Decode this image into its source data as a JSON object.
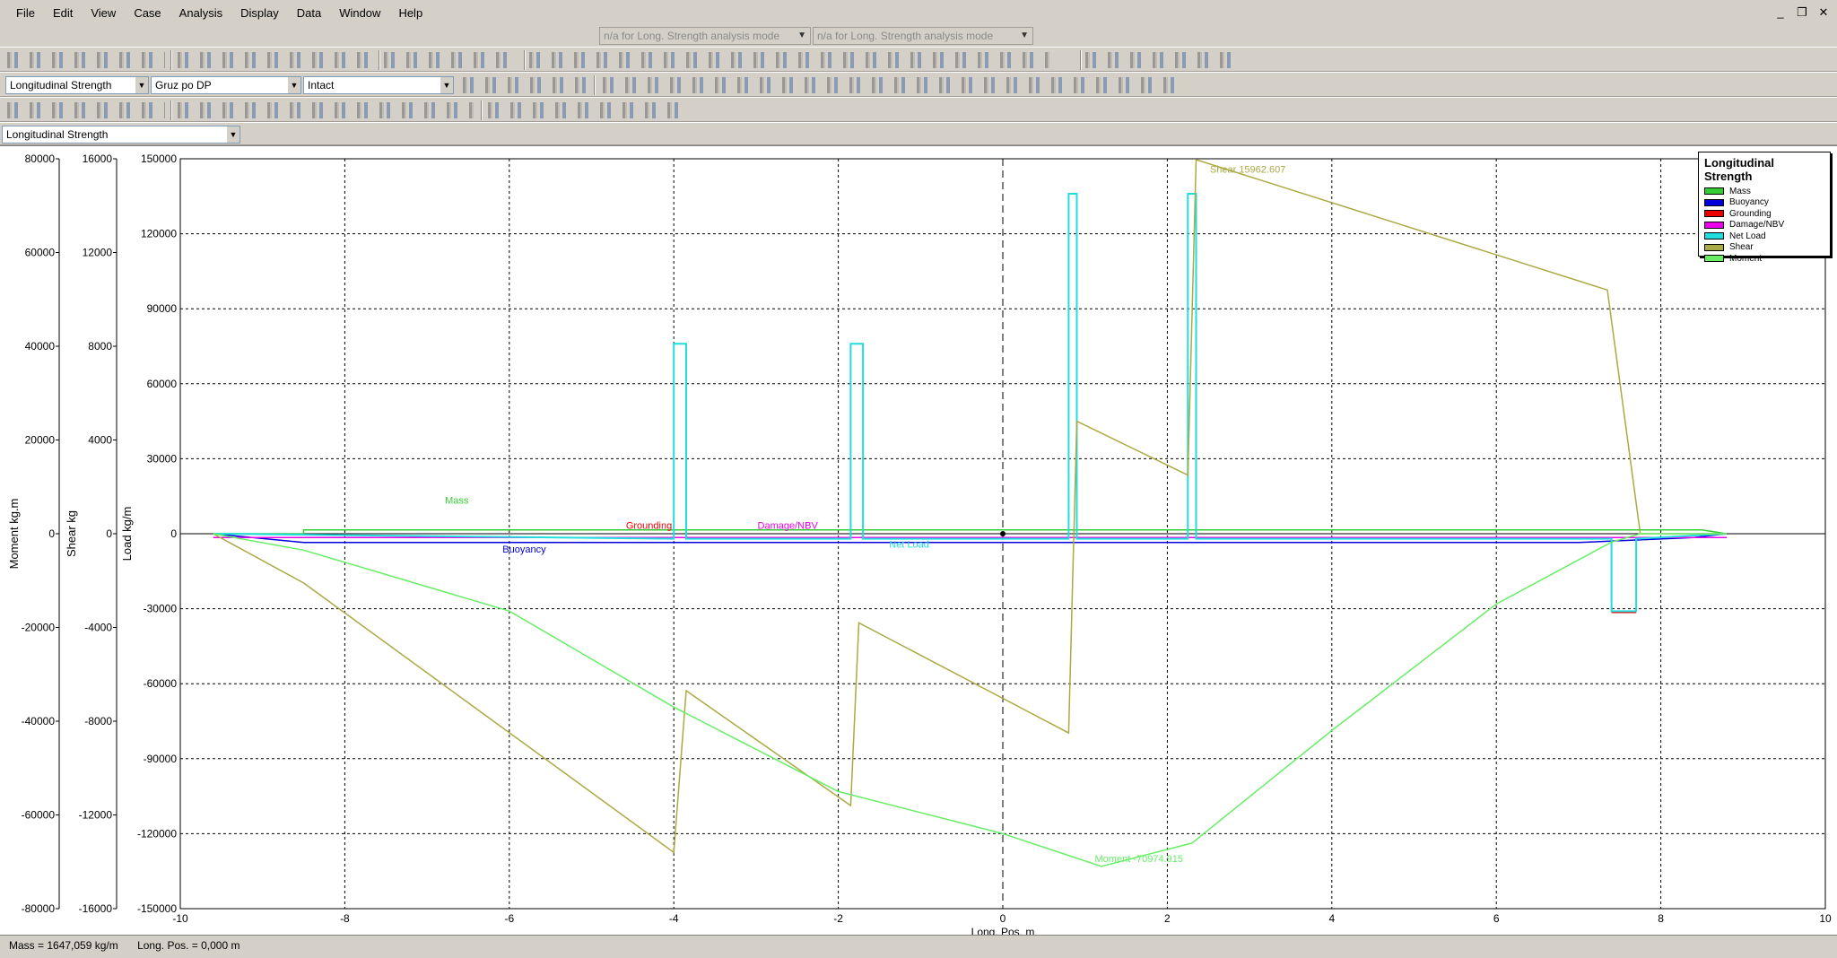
{
  "menu": [
    "File",
    "Edit",
    "View",
    "Case",
    "Analysis",
    "Display",
    "Data",
    "Window",
    "Help"
  ],
  "window_controls": [
    "_",
    "❐",
    "✕"
  ],
  "mode_combos": [
    "n/a for Long. Strength analysis mode",
    "n/a for Long. Strength analysis mode"
  ],
  "toolbar": {
    "analysis_type": "Longitudinal Strength",
    "loadcase": "Gruz po DP",
    "damage_case": "Intact",
    "graph_select": "Longitudinal Strength"
  },
  "legend": {
    "title": "Longitudinal Strength",
    "items": [
      {
        "label": "Mass",
        "color": "#33cc33"
      },
      {
        "label": "Buoyancy",
        "color": "#0000dd"
      },
      {
        "label": "Grounding",
        "color": "#ee0000"
      },
      {
        "label": "Damage/NBV",
        "color": "#ee00ee"
      },
      {
        "label": "Net Load",
        "color": "#22dddd"
      },
      {
        "label": "Shear",
        "color": "#aaaa44"
      },
      {
        "label": "Moment",
        "color": "#66ee66"
      }
    ]
  },
  "chart_data": {
    "type": "line",
    "xlabel": "Long. Pos.  m",
    "xlim": [
      -10,
      10
    ],
    "x_ticks": [
      "-10",
      "-8",
      "-6",
      "-4",
      "-2",
      "0",
      "2",
      "4",
      "6",
      "8",
      "10"
    ],
    "axes": [
      {
        "label": "Load  kg/m",
        "ylim": [
          -150000,
          150000
        ],
        "ticks": [
          "150000",
          "120000",
          "90000",
          "60000",
          "30000",
          "0",
          "-30000",
          "-60000",
          "-90000",
          "-120000",
          "-150000"
        ]
      },
      {
        "label": "Shear  kg",
        "ylim": [
          -16000,
          16000
        ],
        "ticks": [
          "16000",
          "12000",
          "8000",
          "4000",
          "0",
          "-4000",
          "-8000",
          "-12000",
          "-16000"
        ]
      },
      {
        "label": "Moment  kg.m",
        "ylim": [
          -80000,
          80000
        ],
        "ticks": [
          "80000",
          "60000",
          "40000",
          "20000",
          "0",
          "-20000",
          "-40000",
          "-60000",
          "-80000"
        ]
      }
    ],
    "grid": true,
    "legend_position": "top-right",
    "series": [
      {
        "name": "Mass",
        "axis": "Load",
        "x": [
          -9.6,
          -8.5,
          -8.5,
          8.4,
          8.5,
          8.8
        ],
        "y": [
          0,
          0,
          1500,
          1500,
          1500,
          0
        ]
      },
      {
        "name": "Buoyancy",
        "axis": "Load",
        "x": [
          -9.6,
          -8.5,
          0,
          7.0,
          8.4,
          8.8
        ],
        "y": [
          0,
          -3500,
          -3500,
          -3500,
          -1500,
          0
        ]
      },
      {
        "name": "Grounding",
        "axis": "Load",
        "x": [
          7.4,
          7.7
        ],
        "y": [
          -31500,
          -31500
        ]
      },
      {
        "name": "Damage/NBV",
        "axis": "Load",
        "x": [
          -9.6,
          8.8
        ],
        "y": [
          -1500,
          -1500
        ]
      },
      {
        "name": "Net Load",
        "axis": "Load",
        "x": [
          -9.6,
          -4.0,
          -4.0,
          -3.85,
          -3.85,
          -1.85,
          -1.85,
          -1.7,
          -1.7,
          0.8,
          0.8,
          0.9,
          0.9,
          2.25,
          2.25,
          2.35,
          2.35,
          7.4,
          7.4,
          7.7,
          7.7,
          8.8
        ],
        "y": [
          0,
          -2000,
          76000,
          76000,
          -2000,
          -2000,
          76000,
          76000,
          -2000,
          -2000,
          136000,
          136000,
          -2000,
          -2000,
          136000,
          136000,
          -2000,
          -2000,
          -31000,
          -31000,
          -2000,
          0
        ]
      },
      {
        "name": "Shear",
        "axis": "Shear",
        "x": [
          -9.6,
          -8.5,
          -4.0,
          -3.85,
          -1.85,
          -1.75,
          0.8,
          0.9,
          2.25,
          2.35,
          7.35,
          7.75,
          8.8
        ],
        "y": [
          0,
          -2100,
          -13600,
          -6700,
          -11600,
          -3800,
          -8500,
          4800,
          2500,
          15963,
          10400,
          0,
          0
        ]
      },
      {
        "name": "Moment",
        "axis": "Moment",
        "x": [
          -9.6,
          -8.5,
          -6.0,
          -4.0,
          -2.0,
          0.0,
          1.2,
          2.3,
          4.0,
          6.0,
          7.4,
          7.75,
          8.8
        ],
        "y": [
          0,
          -3500,
          -16500,
          -37000,
          -55000,
          -64000,
          -70975,
          -66000,
          -42000,
          -15000,
          -1800,
          0,
          0
        ]
      }
    ],
    "annotations": [
      "Mass",
      "Grounding",
      "Damage/NBV",
      "Buoyancy",
      "Net Load",
      "Shear 15962.607",
      "Moment -70974.915"
    ]
  },
  "status": {
    "mass": "Mass =  1647,059 kg/m",
    "long_pos": "Long. Pos. =  0,000 m"
  }
}
